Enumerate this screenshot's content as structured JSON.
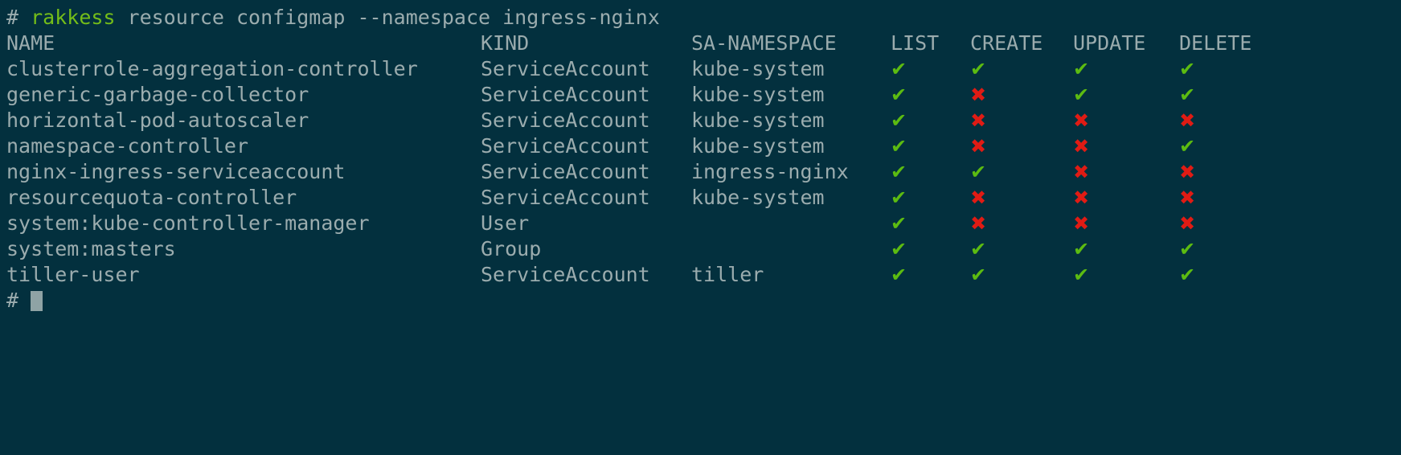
{
  "terminal": {
    "background_color": "#03303e",
    "text_color": "#9bacae",
    "ok_color": "#5cbb11",
    "no_color": "#e01b14",
    "command_highlight_color": "#74bd19"
  },
  "command_line": {
    "prompt": "# ",
    "program": "rakkess",
    "args": " resource configmap --namespace ingress-nginx"
  },
  "table": {
    "headers": {
      "name": "NAME",
      "kind": "KIND",
      "sa_namespace": "SA-NAMESPACE",
      "list": "LIST",
      "create": "CREATE",
      "update": "UPDATE",
      "delete": "DELETE"
    },
    "symbols": {
      "allowed": "✔",
      "denied": "✖"
    },
    "rows": [
      {
        "name": "clusterrole-aggregation-controller",
        "kind": "ServiceAccount",
        "sa_namespace": "kube-system",
        "list": "allowed",
        "create": "allowed",
        "update": "allowed",
        "delete": "allowed"
      },
      {
        "name": "generic-garbage-collector",
        "kind": "ServiceAccount",
        "sa_namespace": "kube-system",
        "list": "allowed",
        "create": "denied",
        "update": "allowed",
        "delete": "allowed"
      },
      {
        "name": "horizontal-pod-autoscaler",
        "kind": "ServiceAccount",
        "sa_namespace": "kube-system",
        "list": "allowed",
        "create": "denied",
        "update": "denied",
        "delete": "denied"
      },
      {
        "name": "namespace-controller",
        "kind": "ServiceAccount",
        "sa_namespace": "kube-system",
        "list": "allowed",
        "create": "denied",
        "update": "denied",
        "delete": "allowed"
      },
      {
        "name": "nginx-ingress-serviceaccount",
        "kind": "ServiceAccount",
        "sa_namespace": "ingress-nginx",
        "list": "allowed",
        "create": "allowed",
        "update": "denied",
        "delete": "denied"
      },
      {
        "name": "resourcequota-controller",
        "kind": "ServiceAccount",
        "sa_namespace": "kube-system",
        "list": "allowed",
        "create": "denied",
        "update": "denied",
        "delete": "denied"
      },
      {
        "name": "system:kube-controller-manager",
        "kind": "User",
        "sa_namespace": "",
        "list": "allowed",
        "create": "denied",
        "update": "denied",
        "delete": "denied"
      },
      {
        "name": "system:masters",
        "kind": "Group",
        "sa_namespace": "",
        "list": "allowed",
        "create": "allowed",
        "update": "allowed",
        "delete": "allowed"
      },
      {
        "name": "tiller-user",
        "kind": "ServiceAccount",
        "sa_namespace": "tiller",
        "list": "allowed",
        "create": "allowed",
        "update": "allowed",
        "delete": "allowed"
      }
    ]
  },
  "final_prompt": {
    "prompt": "# "
  }
}
